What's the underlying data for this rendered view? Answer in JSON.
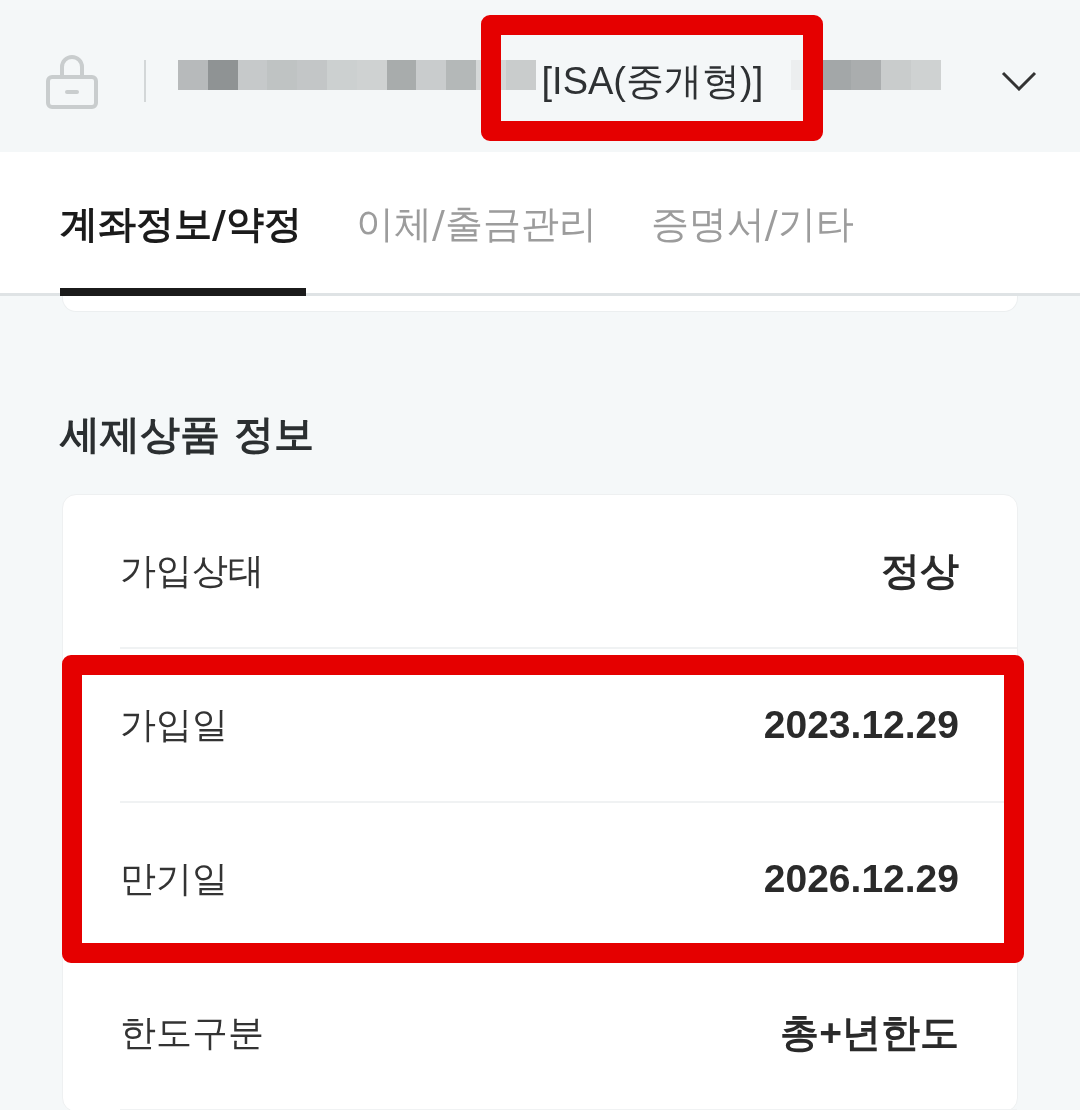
{
  "account_bar": {
    "title": "[ISA(중개형)]",
    "highlighted": true
  },
  "tabs": [
    {
      "label": "계좌정보/약정",
      "selected": true
    },
    {
      "label": "이체/출금관리",
      "selected": false
    },
    {
      "label": "증명서/기타",
      "selected": false
    }
  ],
  "section": {
    "title": "세제상품 정보",
    "rows": [
      {
        "label": "가입상태",
        "value": "정상",
        "highlighted": false
      },
      {
        "label": "가입일",
        "value": "2023.12.29",
        "highlighted": true
      },
      {
        "label": "만기일",
        "value": "2026.12.29",
        "highlighted": true
      },
      {
        "label": "한도구분",
        "value": "총+년한도",
        "highlighted": false
      }
    ]
  }
}
